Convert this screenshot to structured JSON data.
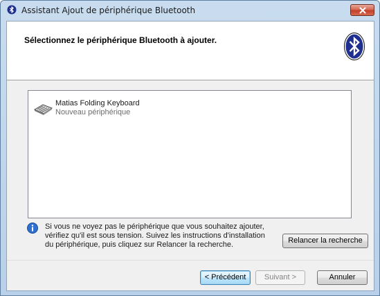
{
  "window": {
    "title": "Assistant Ajout de périphérique Bluetooth",
    "icon": "bluetooth-icon",
    "close_icon": "close-icon"
  },
  "header": {
    "title": "Sélectionnez le périphérique Bluetooth à ajouter.",
    "logo": "bluetooth-logo"
  },
  "devices": [
    {
      "name": "Matias Folding Keyboard",
      "status": "Nouveau périphérique",
      "icon": "keyboard-icon"
    }
  ],
  "info": {
    "icon": "info-icon",
    "lines": [
      "Si vous ne voyez pas le périphérique que vous souhaitez ajouter,",
      "vérifiez qu'il est sous tension. Suivez les instructions d'installation",
      "du périphérique, puis cliquez sur Relancer la recherche."
    ]
  },
  "buttons": {
    "restart": "Relancer la recherche",
    "previous": "< Précédent",
    "next": "Suivant >",
    "cancel": "Annuler"
  },
  "colors": {
    "bluetooth_blue": "#1f2f8f",
    "close_red": "#c3402a",
    "default_button_border": "#3c7fb1"
  }
}
